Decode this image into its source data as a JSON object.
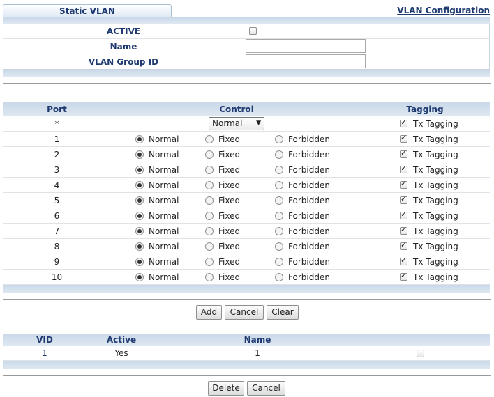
{
  "header": {
    "tab_label": "Static VLAN",
    "link_label": "VLAN Configuration"
  },
  "form": {
    "active_label": "ACTIVE",
    "active_checked": false,
    "name_label": "Name",
    "name_value": "",
    "group_label": "VLAN Group ID",
    "group_value": ""
  },
  "port_table": {
    "col_port": "Port",
    "col_control": "Control",
    "col_tagging": "Tagging",
    "all_row_port": "*",
    "all_row_control": "Normal",
    "opt_normal": "Normal",
    "opt_fixed": "Fixed",
    "opt_forbidden": "Forbidden",
    "tag_label": "Tx Tagging",
    "rows": [
      {
        "port": "1",
        "control": "normal",
        "tx_tagging": true
      },
      {
        "port": "2",
        "control": "normal",
        "tx_tagging": true
      },
      {
        "port": "3",
        "control": "normal",
        "tx_tagging": true
      },
      {
        "port": "4",
        "control": "normal",
        "tx_tagging": true
      },
      {
        "port": "5",
        "control": "normal",
        "tx_tagging": true
      },
      {
        "port": "6",
        "control": "normal",
        "tx_tagging": true
      },
      {
        "port": "7",
        "control": "normal",
        "tx_tagging": true
      },
      {
        "port": "8",
        "control": "normal",
        "tx_tagging": true
      },
      {
        "port": "9",
        "control": "normal",
        "tx_tagging": true
      },
      {
        "port": "10",
        "control": "normal",
        "tx_tagging": true
      }
    ]
  },
  "actions": {
    "add": "Add",
    "cancel": "Cancel",
    "clear": "Clear"
  },
  "vlan_table": {
    "col_vid": "VID",
    "col_active": "Active",
    "col_name": "Name",
    "rows": [
      {
        "vid": "1",
        "active": "Yes",
        "name": "1",
        "selected": false
      }
    ]
  },
  "bottom_actions": {
    "delete": "Delete",
    "cancel": "Cancel"
  }
}
